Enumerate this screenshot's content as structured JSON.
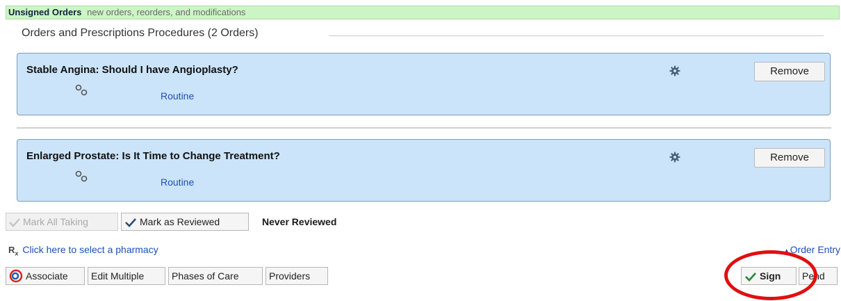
{
  "header": {
    "title": "Unsigned Orders",
    "subtitle": "new orders, reorders, and modifications"
  },
  "section": {
    "title": "Orders and Prescriptions Procedures (2 Orders)"
  },
  "orders": [
    {
      "title": "Stable Angina: Should I have Angioplasty?",
      "priority": "Routine",
      "remove_label": "Remove"
    },
    {
      "title": "Enlarged Prostate: Is It Time to Change Treatment?",
      "priority": "Routine",
      "remove_label": "Remove"
    }
  ],
  "review": {
    "mark_all_taking": "Mark All Taking",
    "mark_reviewed": "Mark as Reviewed",
    "status": "Never Reviewed"
  },
  "pharmacy": {
    "rx_symbol": "R",
    "rx_sub": "x",
    "link": "Click here to select a pharmacy"
  },
  "order_entry": "Order Entry",
  "toolbar": {
    "associate": "Associate",
    "edit_multiple": "Edit Multiple",
    "phases": "Phases of Care",
    "providers": "Providers",
    "sign": "Sign",
    "pend": "Pend"
  },
  "colors": {
    "header_bg": "#ccf5c5",
    "order_bg": "#cce4f9",
    "link": "#1f4fb0",
    "highlight_circle": "#e01010"
  }
}
